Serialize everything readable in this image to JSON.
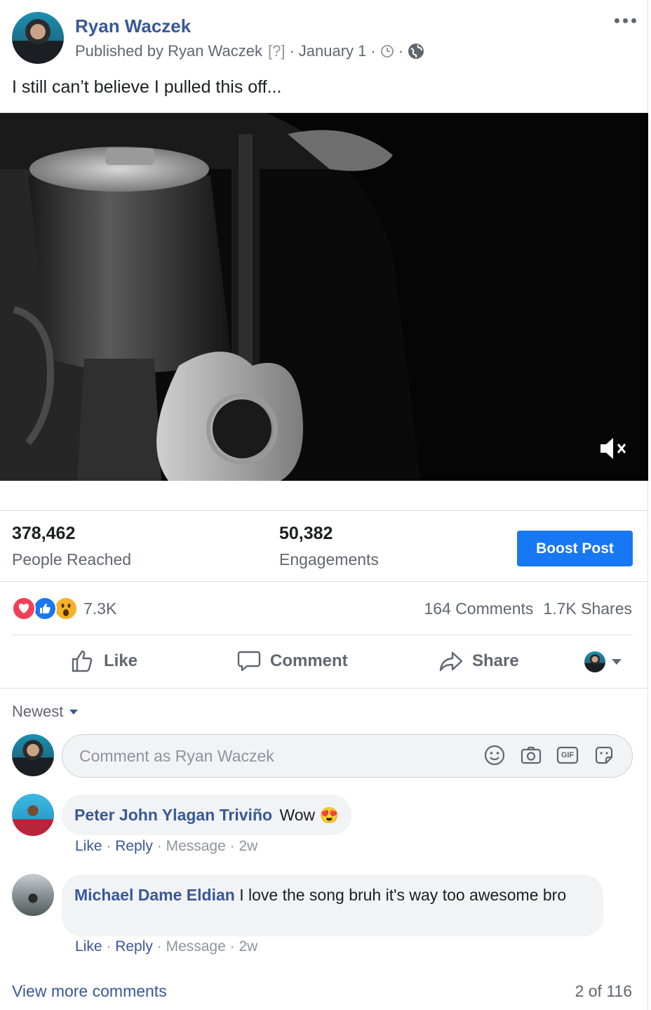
{
  "post": {
    "author": "Ryan Waczek",
    "published_by": "Published by Ryan Waczek",
    "help_marker": "[?]",
    "date": "January 1",
    "message": "I still can’t believe I pulled this off..."
  },
  "video": {
    "muted": true
  },
  "insights": {
    "reached_value": "378,462",
    "reached_label": "People Reached",
    "engagements_value": "50,382",
    "engagements_label": "Engagements",
    "boost_label": "Boost Post"
  },
  "reactions": {
    "types": [
      "love",
      "like",
      "wow"
    ],
    "count": "7.3K",
    "comments": "164 Comments",
    "shares": "1.7K Shares"
  },
  "actions": {
    "like": "Like",
    "comment": "Comment",
    "share": "Share"
  },
  "comments_section": {
    "sort_label": "Newest",
    "input_placeholder": "Comment as Ryan Waczek",
    "gif_label": "GIF",
    "items": [
      {
        "author": "Peter John Ylagan Triviño",
        "text": "Wow",
        "emoji": "😍",
        "like": "Like",
        "reply": "Reply",
        "message": "Message",
        "time": "2w"
      },
      {
        "author": "Michael Dame Eldian",
        "text": "I love the song bruh it's way too awesome bro",
        "like": "Like",
        "reply": "Reply",
        "message": "Message",
        "time": "2w"
      }
    ],
    "view_more": "View more comments",
    "pagination": "2 of 116"
  },
  "colors": {
    "link": "#385898",
    "boost": "#1877f2",
    "muted_text": "#606770"
  }
}
